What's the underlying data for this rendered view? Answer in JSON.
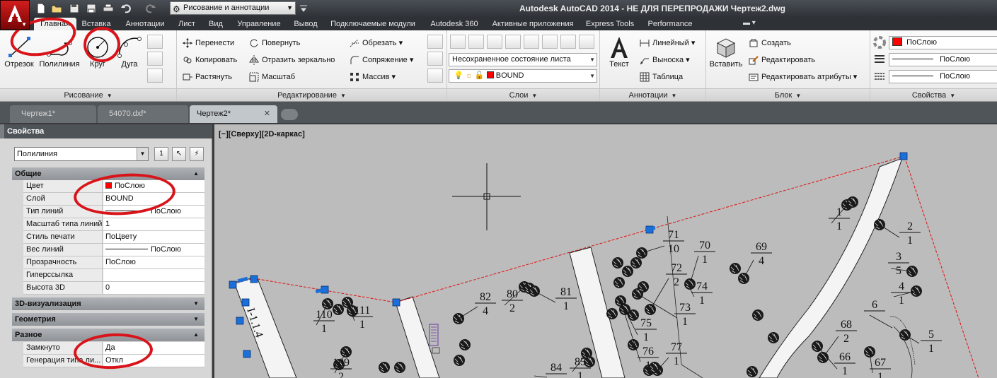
{
  "titlebar": {
    "workspace": "Рисование и аннотации",
    "title": "Autodesk AutoCAD 2014 - НЕ ДЛЯ ПЕРЕПРОДАЖИ   Чертеж2.dwg"
  },
  "ribbon_tabs": [
    {
      "label": "Главная",
      "active": true
    },
    {
      "label": "Вставка"
    },
    {
      "label": "Аннотации"
    },
    {
      "label": "Лист"
    },
    {
      "label": "Вид"
    },
    {
      "label": "Управление"
    },
    {
      "label": "Вывод"
    },
    {
      "label": "Подключаемые модули"
    },
    {
      "label": "Autodesk 360"
    },
    {
      "label": "Активные приложения"
    },
    {
      "label": "Express Tools"
    },
    {
      "label": "Performance"
    }
  ],
  "ribbon": {
    "draw": {
      "title": "Рисование",
      "line": "Отрезок",
      "polyline": "Полилиния",
      "circle": "Круг",
      "arc": "Дуга"
    },
    "modify": {
      "title": "Редактирование",
      "move": "Перенести",
      "rotate": "Повернуть",
      "trim": "Обрезать",
      "copy": "Копировать",
      "mirror": "Отразить зеркально",
      "fillet": "Сопряжение",
      "stretch": "Растянуть",
      "scale": "Масштаб",
      "array": "Массив"
    },
    "layers": {
      "title": "Слои",
      "state": "Несохраненное состояние листа",
      "current_layer": "BOUND"
    },
    "annotation": {
      "title": "Аннотации",
      "text": "Текст",
      "linear": "Линейный",
      "leader": "Выноска",
      "table": "Таблица"
    },
    "block": {
      "title": "Блок",
      "insert": "Вставить",
      "create": "Создать",
      "edit": "Редактировать",
      "edit_attr": "Редактировать атрибуты"
    },
    "properties": {
      "title": "Свойства",
      "color": "ПоСлою",
      "linetype": "ПоСлою",
      "lineweight": "ПоСлою"
    }
  },
  "file_tabs": [
    {
      "label": "Чертеж1*"
    },
    {
      "label": "54070.dxf*"
    },
    {
      "label": "Чертеж2*",
      "active": true
    }
  ],
  "props": {
    "header": "Свойства",
    "object": "Полилиния",
    "sections": {
      "general": "Общие",
      "viz3d": "3D-визуализация",
      "geometry": "Геометрия",
      "misc": "Разное"
    },
    "general_rows": [
      {
        "k": "Цвет",
        "v": "ПоСлою"
      },
      {
        "k": "Слой",
        "v": "BOUND"
      },
      {
        "k": "Тип линий",
        "v": "ПоСлою"
      },
      {
        "k": "Масштаб типа линий",
        "v": "1"
      },
      {
        "k": "Стиль печати",
        "v": "ПоЦвету"
      },
      {
        "k": "Вес линий",
        "v": "ПоСлою"
      },
      {
        "k": "Прозрачность",
        "v": "ПоСлою"
      },
      {
        "k": "Гиперссылка",
        "v": ""
      },
      {
        "k": "Высота 3D",
        "v": "0"
      }
    ],
    "misc_rows": [
      {
        "k": "Замкнуто",
        "v": "Да"
      },
      {
        "k": "Генерация типа ли...",
        "v": "Откл"
      }
    ]
  },
  "viewport": {
    "label": "[−][Сверху][2D-каркас]",
    "street_label": "I-1.1.4",
    "plot_labels": [
      {
        "n": "1",
        "d": "1"
      },
      {
        "n": "2",
        "d": "1"
      },
      {
        "n": "3",
        "d": "5"
      },
      {
        "n": "4",
        "d": "1"
      },
      {
        "n": "5",
        "d": "1"
      },
      {
        "n": "6",
        "d": ""
      },
      {
        "n": "66",
        "d": "1"
      },
      {
        "n": "67",
        "d": "1"
      },
      {
        "n": "68",
        "d": "2"
      },
      {
        "n": "69",
        "d": "4"
      },
      {
        "n": "70",
        "d": "1"
      },
      {
        "n": "71",
        "d": "10"
      },
      {
        "n": "72",
        "d": "2"
      },
      {
        "n": "73",
        "d": "1"
      },
      {
        "n": "74",
        "d": "1"
      },
      {
        "n": "75",
        "d": "1"
      },
      {
        "n": "76",
        "d": "1"
      },
      {
        "n": "77",
        "d": "1"
      },
      {
        "n": "80",
        "d": "2"
      },
      {
        "n": "81",
        "d": "1"
      },
      {
        "n": "82",
        "d": "4"
      },
      {
        "n": "84",
        "d": ""
      },
      {
        "n": "85",
        "d": "1"
      },
      {
        "n": "109",
        "d": "2"
      },
      {
        "n": "110",
        "d": "1"
      },
      {
        "n": "111",
        "d": "1"
      }
    ]
  },
  "colors": {
    "accent_red": "#d8141a",
    "layer_red": "#ff0000",
    "grip_blue": "#1a6fd8",
    "boundary": "#e01010"
  }
}
